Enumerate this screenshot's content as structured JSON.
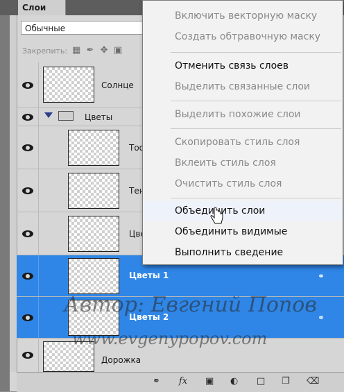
{
  "panel": {
    "tab_label": "Слои",
    "blend_mode": "Обычные",
    "lock_label": "Закрепить:"
  },
  "layers": [
    {
      "name": "Солнце",
      "selected": false
    },
    {
      "name": "Цветы",
      "selected": false,
      "group": true
    },
    {
      "name": "Тоо",
      "selected": false
    },
    {
      "name": "Тен",
      "selected": false
    },
    {
      "name": "Цве",
      "selected": false
    },
    {
      "name": "Цветы 1",
      "selected": true
    },
    {
      "name": "Цветы 2",
      "selected": true
    },
    {
      "name": "Дорожка",
      "selected": false
    }
  ],
  "menu": {
    "items": [
      {
        "label": "Включить векторную маску",
        "enabled": false
      },
      {
        "label": "Создать обтравочную маску",
        "enabled": false
      },
      {
        "label": "Отменить связь слоев",
        "enabled": true
      },
      {
        "label": "Выделить связанные слои",
        "enabled": false
      },
      {
        "label": "Выделить похожие слои",
        "enabled": false
      },
      {
        "label": "Скопировать стиль слоя",
        "enabled": false
      },
      {
        "label": "Вклеить стиль слоя",
        "enabled": false
      },
      {
        "label": "Очистить стиль слоя",
        "enabled": false
      },
      {
        "label": "Объединить слои",
        "enabled": true,
        "hovered": true
      },
      {
        "label": "Объединить видимые",
        "enabled": true
      },
      {
        "label": "Выполнить сведение",
        "enabled": true
      }
    ]
  },
  "watermark": {
    "line1": "Автор: Евгений Попов",
    "line2": "www.evgenypopov.com"
  },
  "colors": {
    "selection": "#2f86e6",
    "menu_bg": "#f2f2f2",
    "panel_bg": "#d6d6d6"
  },
  "bottom_icons": [
    "link-icon",
    "fx-icon",
    "mask-icon",
    "adjustment-icon",
    "folder-icon",
    "new-layer-icon",
    "trash-icon"
  ]
}
